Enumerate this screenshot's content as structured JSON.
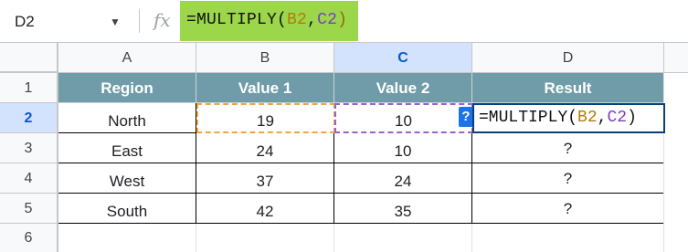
{
  "formula_bar": {
    "cell_ref": "D2",
    "fx_label": "fx",
    "formula_prefix": "=MULTIPLY(",
    "formula_ref_b": "B2",
    "formula_sep": ",",
    "formula_ref_c": "C2",
    "formula_suffix": ")"
  },
  "columns": [
    "A",
    "B",
    "C",
    "D"
  ],
  "rows": [
    "1",
    "2",
    "3",
    "4",
    "5",
    "6"
  ],
  "table": {
    "headers": [
      "Region",
      "Value 1",
      "Value 2",
      "Result"
    ],
    "rows": [
      [
        "North",
        "19",
        "10",
        ""
      ],
      [
        "East",
        "24",
        "10",
        "?"
      ],
      [
        "West",
        "37",
        "24",
        "?"
      ],
      [
        "South",
        "42",
        "35",
        "?"
      ]
    ]
  },
  "editor": {
    "badge": "?",
    "prefix": "=MULTIPLY(",
    "ref_b": "B2",
    "sep": ",",
    "ref_c": "C2",
    "suffix": ")"
  },
  "colors": {
    "header_fill": "#6f9ca8",
    "formula_highlight": "#9cd64a",
    "ref_b_color": "#f0a63c",
    "ref_c_color": "#9a63c9",
    "selection_blue": "#d3e3fd"
  }
}
